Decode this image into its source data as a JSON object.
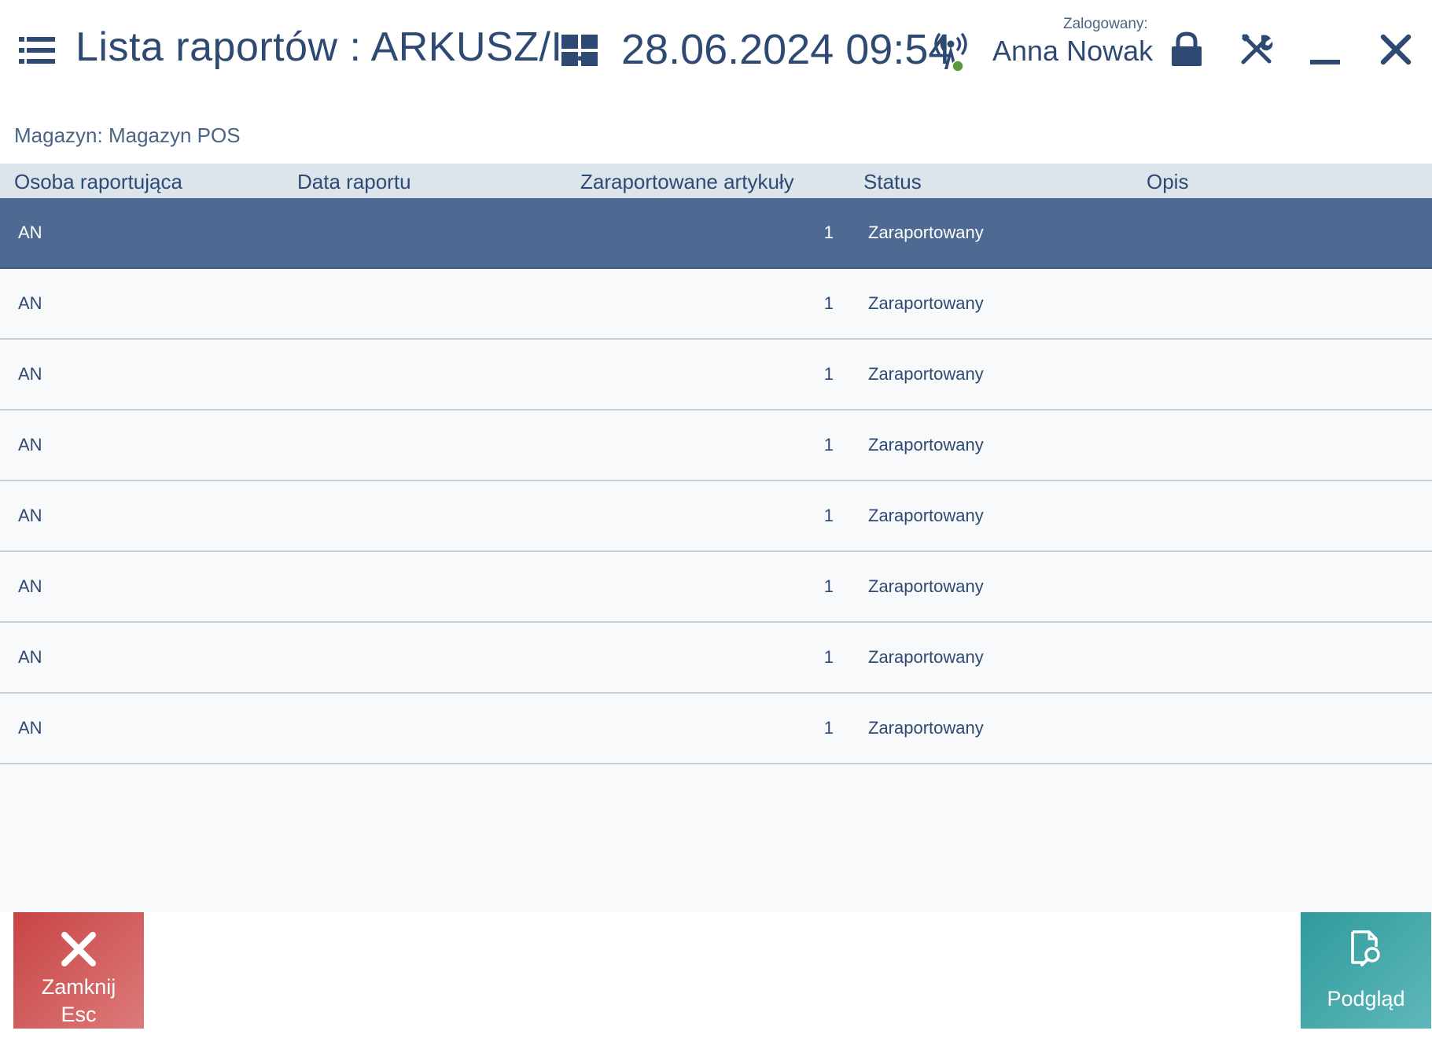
{
  "header": {
    "title": "Lista raportów : ARKUSZ/I...",
    "datetime": "28.06.2024 09:54",
    "logged_in_label": "Zalogowany:",
    "user_name": "Anna Nowak",
    "icons": [
      "menu-icon",
      "tiles-icon",
      "signal-icon",
      "lock-icon",
      "tools-icon",
      "minimize-icon",
      "close-icon"
    ],
    "connection_status_color": "#5a9a3a"
  },
  "warehouse": {
    "label": "Magazyn: Magazyn POS"
  },
  "table": {
    "columns": [
      "Osoba raportująca",
      "Data raportu",
      "Zaraportowane artykuły",
      "Status",
      "Opis"
    ],
    "selected_row": 0,
    "rows": [
      {
        "person": "AN",
        "date": "",
        "count": "1",
        "status": "Zaraportowany",
        "description": ""
      },
      {
        "person": "AN",
        "date": "",
        "count": "1",
        "status": "Zaraportowany",
        "description": ""
      },
      {
        "person": "AN",
        "date": "",
        "count": "1",
        "status": "Zaraportowany",
        "description": ""
      },
      {
        "person": "AN",
        "date": "",
        "count": "1",
        "status": "Zaraportowany",
        "description": ""
      },
      {
        "person": "AN",
        "date": "",
        "count": "1",
        "status": "Zaraportowany",
        "description": ""
      },
      {
        "person": "AN",
        "date": "",
        "count": "1",
        "status": "Zaraportowany",
        "description": ""
      },
      {
        "person": "AN",
        "date": "",
        "count": "1",
        "status": "Zaraportowany",
        "description": ""
      },
      {
        "person": "AN",
        "date": "",
        "count": "1",
        "status": "Zaraportowany",
        "description": ""
      }
    ]
  },
  "footer": {
    "close_button": {
      "label": "Zamknij",
      "shortcut": "Esc",
      "icon": "close-icon"
    },
    "preview_button": {
      "label": "Podgląd",
      "icon": "document-search-icon"
    }
  },
  "colors": {
    "accent": "#2e4a73",
    "selected_row": "#4e6a93",
    "header_bg": "#dce4ec",
    "close_button": "#d05a5a",
    "preview_button": "#45a9aa"
  }
}
